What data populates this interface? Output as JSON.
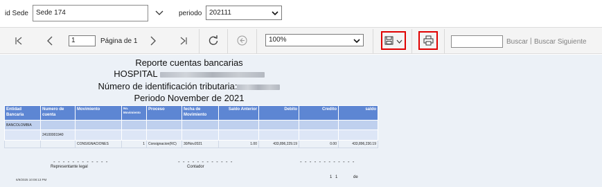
{
  "params": {
    "sede_label": "id Sede",
    "sede_value": "Sede 174",
    "periodo_label": "periodo",
    "periodo_value": "202111"
  },
  "toolbar": {
    "page_number": "1",
    "page_label": "Página de 1",
    "zoom": "100%",
    "find_link": "Buscar",
    "separator": "|",
    "find_next_link": "Buscar Siguiente"
  },
  "report": {
    "title": "Reporte cuentas bancarias",
    "hospital_label": "HOSPITAL",
    "nit_label": "Número de identificación tributaria:",
    "period_line": "Periodo November de 2021",
    "columns": [
      "Entidad Bancaria",
      "Numero de cuenta",
      "Movimiento",
      "No. Movimiento",
      "Proceso",
      "fecha de Movimiento",
      "Saldo Anterior",
      "Debito",
      "Credito",
      "saldo"
    ],
    "group_bank": "BANCOLOMBIA",
    "group_account": "24100001940",
    "detail": {
      "movimiento": "CONSIGNACIONES",
      "no_movimiento": "1",
      "proceso": "Consignacion(RC)",
      "fecha": "30/Nov2021",
      "saldo_anterior": "1.00",
      "debito": "433,896,229.19",
      "credito": "0.00",
      "saldo": "433,896,230.19"
    },
    "signatures": {
      "dashes": "- - - - - - - - - - - -",
      "rep_legal": "Representante legal",
      "contador": "Contador"
    },
    "footer": {
      "timestamp": "6/9/2025 10:08:13 PM",
      "page_num_a": "1",
      "page_num_b": "1",
      "de": "de"
    }
  },
  "colors": {
    "header_bg": "#5d86d3",
    "group_bg": "#bfd0ee",
    "report_bg": "#ecf1f7",
    "highlight": "#e00000"
  },
  "icons": [
    "chevron-down-icon",
    "first-page-icon",
    "prev-page-icon",
    "next-page-icon",
    "last-page-icon",
    "refresh-icon",
    "back-icon",
    "save-icon",
    "print-icon"
  ]
}
